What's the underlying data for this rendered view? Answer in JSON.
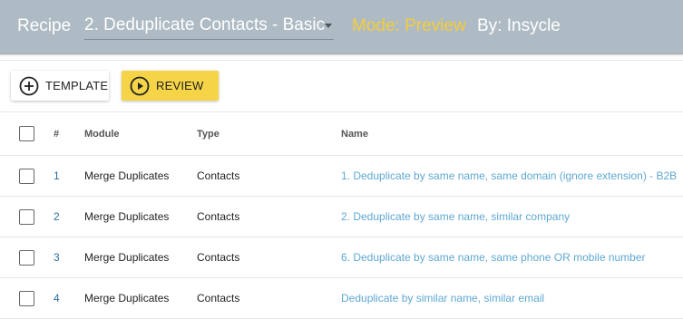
{
  "header": {
    "recipe_label": "Recipe",
    "recipe_value": "2. Deduplicate Contacts - Basic",
    "mode": "Mode: Preview",
    "by": "By: Insycle",
    "colors": {
      "bar": "#aebbc4",
      "mode": "#f5cd3a"
    }
  },
  "toolbar": {
    "template_label": "TEMPLATE",
    "template_icon": "plus-circle-icon",
    "review_label": "REVIEW",
    "review_icon": "play-circle-icon",
    "review_color": "#f5d447"
  },
  "table": {
    "columns": {
      "num": "#",
      "module": "Module",
      "type": "Type",
      "name": "Name"
    },
    "rows": [
      {
        "num": "1",
        "module": "Merge Duplicates",
        "type": "Contacts",
        "name": "1. Deduplicate by same name, same domain (ignore extension) - B2B"
      },
      {
        "num": "2",
        "module": "Merge Duplicates",
        "type": "Contacts",
        "name": "2. Deduplicate by same name, similar company"
      },
      {
        "num": "3",
        "module": "Merge Duplicates",
        "type": "Contacts",
        "name": "6. Deduplicate by same name, same phone OR mobile number"
      },
      {
        "num": "4",
        "module": "Merge Duplicates",
        "type": "Contacts",
        "name": "Deduplicate by similar name, similar email"
      }
    ]
  }
}
